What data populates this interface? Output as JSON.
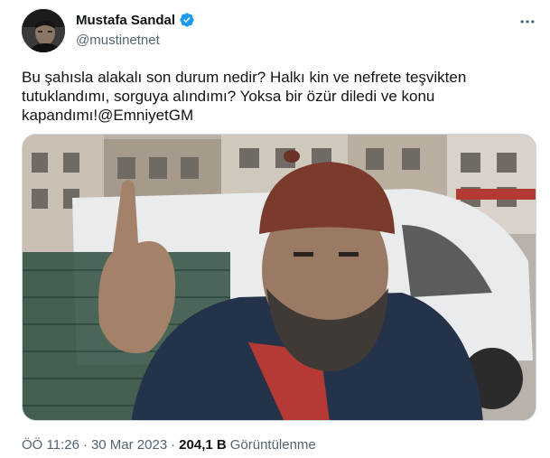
{
  "author": {
    "display_name": "Mustafa Sandal",
    "handle": "@mustinetnet",
    "verified": true
  },
  "tweet": {
    "text": "Bu şahısla alakalı son durum nedir? Halkı kin ve nefrete teşvikten tutuklandımı, sorguya alındımı? Yoksa bir özür diledi ve konu kapandımı!@EmniyetGM"
  },
  "meta": {
    "time": "ÖÖ 11:26",
    "separator": "·",
    "date": "30 Mar 2023",
    "views_count": "204,1 B",
    "views_label": "Görüntülenme"
  },
  "colors": {
    "verified_badge": "#1d9bf0",
    "secondary_text": "#536471",
    "primary_text": "#0f1419"
  },
  "icons": {
    "more": "more-dots-icon",
    "verified": "verified-badge-icon"
  }
}
